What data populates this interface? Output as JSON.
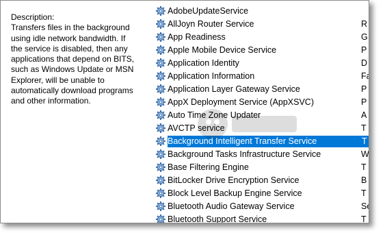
{
  "description": {
    "heading": "Description:",
    "text": "Transfers files in the background using idle network bandwidth. If the service is disabled, then any applications that depend on BITS, such as Windows Update or MSN Explorer, will be unable to automatically download programs and other information."
  },
  "services": [
    {
      "name": "AdobeUpdateService",
      "col2": ""
    },
    {
      "name": "AllJoyn Router Service",
      "col2": "R"
    },
    {
      "name": "App Readiness",
      "col2": "G"
    },
    {
      "name": "Apple Mobile Device Service",
      "col2": "P"
    },
    {
      "name": "Application Identity",
      "col2": "D"
    },
    {
      "name": "Application Information",
      "col2": "Fa"
    },
    {
      "name": "Application Layer Gateway Service",
      "col2": "P"
    },
    {
      "name": "AppX Deployment Service (AppXSVC)",
      "col2": "P"
    },
    {
      "name": "Auto Time Zone Updater",
      "col2": "A"
    },
    {
      "name": "AVCTP service",
      "col2": "T"
    },
    {
      "name": "Background Intelligent Transfer Service",
      "col2": "T",
      "selected": true
    },
    {
      "name": "Background Tasks Infrastructure Service",
      "col2": "W"
    },
    {
      "name": "Base Filtering Engine",
      "col2": "T"
    },
    {
      "name": "BitLocker Drive Encryption Service",
      "col2": "B"
    },
    {
      "name": "Block Level Backup Engine Service",
      "col2": "T"
    },
    {
      "name": "Bluetooth Audio Gateway Service",
      "col2": "Se"
    },
    {
      "name": "Bluetooth Support Service",
      "col2": "T"
    }
  ],
  "colors": {
    "selection": "#0078d7",
    "gear_icon": "#3f6fa8"
  },
  "icons": {
    "service": "gear-icon"
  }
}
